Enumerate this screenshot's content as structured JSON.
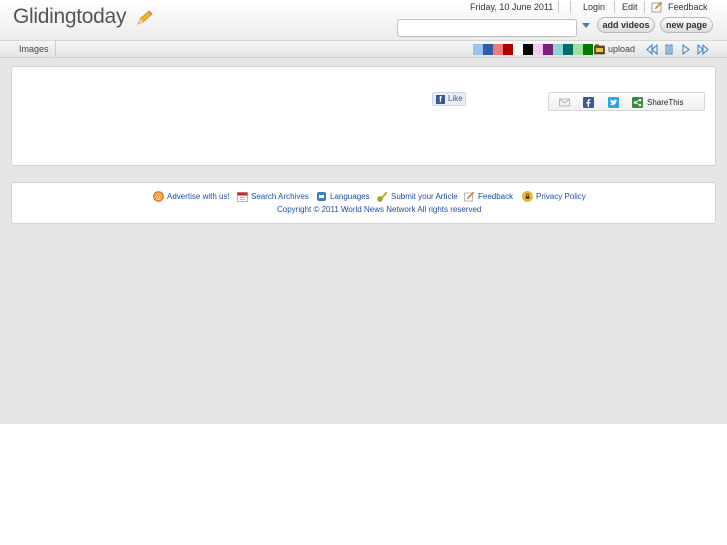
{
  "header": {
    "logo_text": "Glidingtoday",
    "date": "Friday, 10 June 2011",
    "login_label": "Login",
    "edit_label": "Edit",
    "feedback_label": "Feedback",
    "search_placeholder": "",
    "add_videos_label": "add videos",
    "new_page_label": "new page"
  },
  "nav": {
    "images_label": "Images",
    "upload_label": "upload",
    "swatch_colors": [
      "#9bc3ee",
      "#2f5ea8",
      "#f07a7a",
      "#b00000",
      "#ffffff",
      "#000000",
      "#f4c8f0",
      "#7a1f7a",
      "#8fd4d4",
      "#006b6b",
      "#9ee09e",
      "#007a00"
    ]
  },
  "social": {
    "like_label": "Like",
    "sharethis_label": "ShareThis"
  },
  "footer": {
    "advertise_label": "Advertise with us!",
    "archives_label": "Search Archives",
    "languages_label": "Languages",
    "submit_label": "Submit your Article",
    "feedback_label": "Feedback",
    "privacy_label": "Privacy Policy",
    "copyright": "Copyright © 2011 World News Network All rights reserved"
  },
  "colors": {
    "link": "#1f4fa3",
    "accent": "#3b7fc4",
    "facebook": "#3b5998",
    "twitter": "#2fa3e6"
  }
}
